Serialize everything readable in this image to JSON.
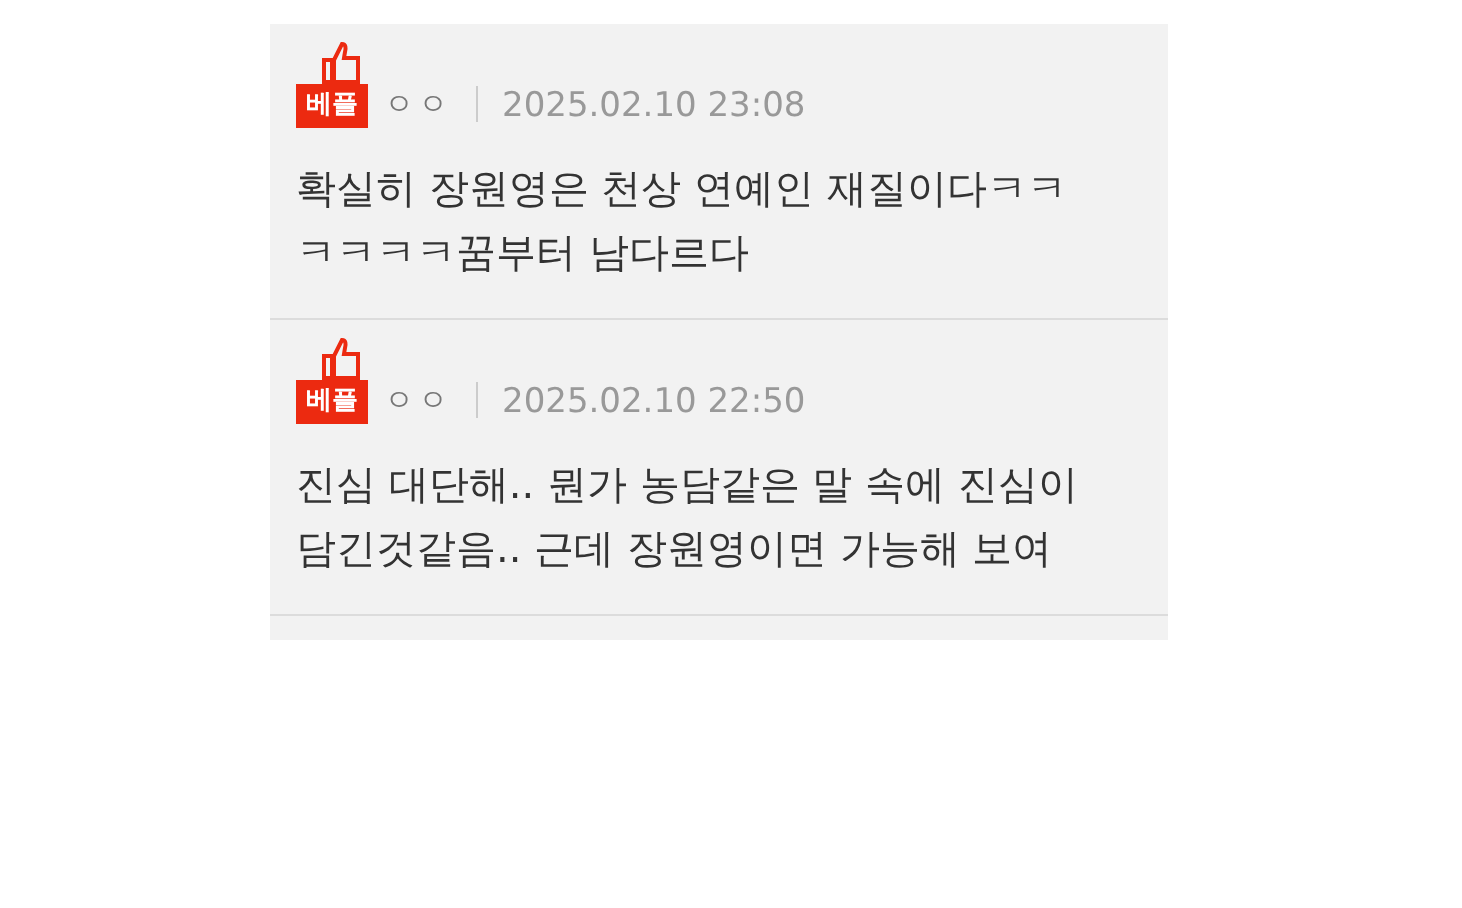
{
  "comments": [
    {
      "badge": "베플",
      "author": "ㅇㅇ",
      "date": "2025.02.10 23:08",
      "lines": [
        "확실히 장원영은 천상 연예인 재질이다ㅋㅋ",
        "ㅋㅋㅋㅋ꿈부터 남다르다"
      ]
    },
    {
      "badge": "베플",
      "author": "ㅇㅇ",
      "date": "2025.02.10 22:50",
      "lines": [
        "진심 대단해.. 뭔가 농담같은 말 속에 진심이",
        "담긴것같음.. 근데 장원영이면 가능해 보여"
      ]
    }
  ]
}
